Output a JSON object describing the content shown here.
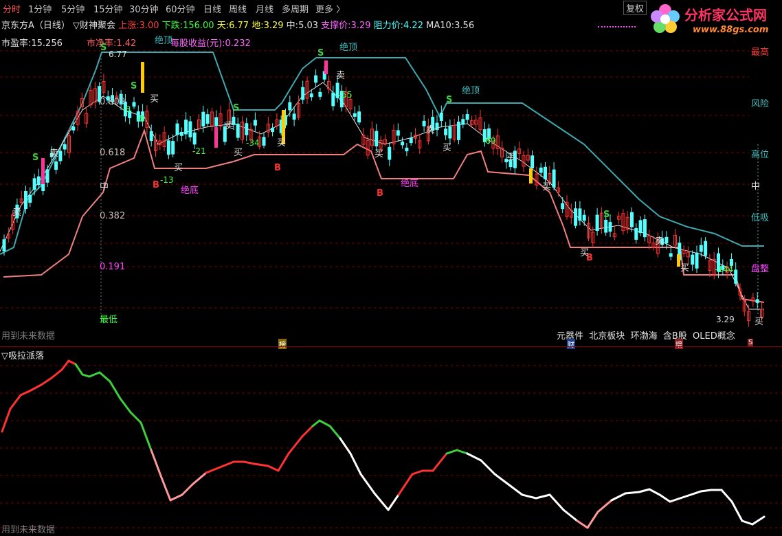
{
  "tabs": [
    "分时",
    "1分钟",
    "5分钟",
    "15分钟",
    "30分钟",
    "60分钟",
    "日线",
    "周线",
    "月线",
    "多周期",
    "更多 〉"
  ],
  "restore_label": "复权",
  "logo": {
    "cn": "分析家公式网",
    "url": "www.88gs.com"
  },
  "info_line": {
    "name": "京东方A（日线）",
    "indicator": "▽财神聚会",
    "up_label": "上涨:",
    "up_value": "3.00",
    "down_label": "下跌:",
    "down_value": "156.00",
    "sky_label": "天:",
    "sky_value": "6.77",
    "ground_label": "地:",
    "ground_value": "3.29",
    "mid_label": "中:",
    "mid_value": "5.03",
    "support_label": "支撑价:",
    "support_value": "3.29",
    "resist_label": "阻力价:",
    "resist_value": "4.22",
    "ma_label": "MA10:",
    "ma_value": "3.56"
  },
  "line2": {
    "pe": "市盈率:15.256",
    "pb": "市净率:1.42",
    "eps": "每股收益(元):0.232"
  },
  "fib_labels": [
    "0.809",
    "0.618",
    "0.382",
    "0.191"
  ],
  "level_labels": {
    "high": "最高",
    "risk": "风险",
    "high_pos": "高位",
    "mid": "中",
    "low_buy": "低吸",
    "consolidate": "盘整",
    "mid_left": "中",
    "low_left": "最低"
  },
  "price_labels": {
    "top": "6.77",
    "bottom": "3.29"
  },
  "signals": {
    "buy": "买",
    "sell": "卖",
    "top": "绝顶",
    "bottom": "绝底",
    "S": "S",
    "B": "B"
  },
  "numbers": [
    "-5",
    "-8",
    "-21",
    "-34",
    "-13",
    "-55",
    "-89",
    "-144"
  ],
  "concepts": [
    "元器件",
    "北京板块",
    "环渤海",
    "含B股",
    "OLED概念"
  ],
  "future_note": "用到未来数据",
  "badges": {
    "bang": "榜",
    "cai": "财",
    "zeng": "增",
    "s": "S"
  },
  "lower_panel": {
    "title": "▽吸拉派落",
    "future_note": "用到未来数据"
  },
  "colors": {
    "up": "#ff3232",
    "down": "#54ffff",
    "upper_band": "#3fa9b0",
    "lower_band": "#f08080",
    "ma": "#e8e8e8",
    "signal_green": "#3cd03c",
    "magenta": "#ff44ff",
    "yellow": "#ffcc00",
    "grid": "#7a0000"
  }
}
